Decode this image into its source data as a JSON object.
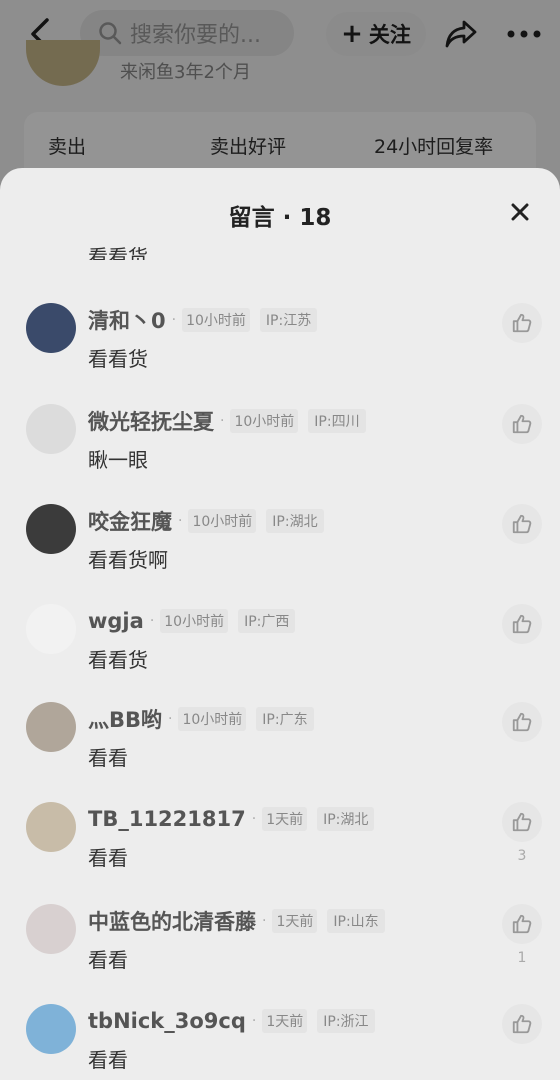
{
  "background": {
    "search_placeholder": "搜索你要的...",
    "follow_label": "关注",
    "shop_subtitle": "来闲鱼3年2个月",
    "stats": [
      "卖出",
      "卖出好评",
      "24小时回复率"
    ]
  },
  "sheet": {
    "title": "留言 · 18",
    "peek_text": "看看货"
  },
  "comments": [
    {
      "name": "清和丶0",
      "time": "10小时前",
      "ip": "IP:江苏",
      "text": "看看货",
      "likes": "",
      "avatar": "#3a4a6a"
    },
    {
      "name": "微光轻抚尘夏",
      "time": "10小时前",
      "ip": "IP:四川",
      "text": "瞅一眼",
      "likes": "",
      "avatar": "#dcdcdc"
    },
    {
      "name": "咬金狂魔",
      "time": "10小时前",
      "ip": "IP:湖北",
      "text": "看看货啊",
      "likes": "",
      "avatar": "#3b3b3b"
    },
    {
      "name": "wgja",
      "time": "10小时前",
      "ip": "IP:广西",
      "text": "看看货",
      "likes": "",
      "avatar": "#f2f2f2"
    },
    {
      "name": "灬BB哟",
      "time": "10小时前",
      "ip": "IP:广东",
      "text": "看看",
      "likes": "",
      "avatar": "#b0a69a"
    },
    {
      "name": "TB_11221817",
      "time": "1天前",
      "ip": "IP:湖北",
      "text": "看看",
      "likes": "3",
      "avatar": "#c8bca8"
    },
    {
      "name": "中蓝色的北清香藤",
      "time": "1天前",
      "ip": "IP:山东",
      "text": "看看",
      "likes": "1",
      "avatar": "#d8d0d0"
    },
    {
      "name": "tbNick_3o9cq",
      "time": "1天前",
      "ip": "IP:浙江",
      "text": "看看",
      "likes": "",
      "avatar": "#7fb2d8"
    }
  ]
}
